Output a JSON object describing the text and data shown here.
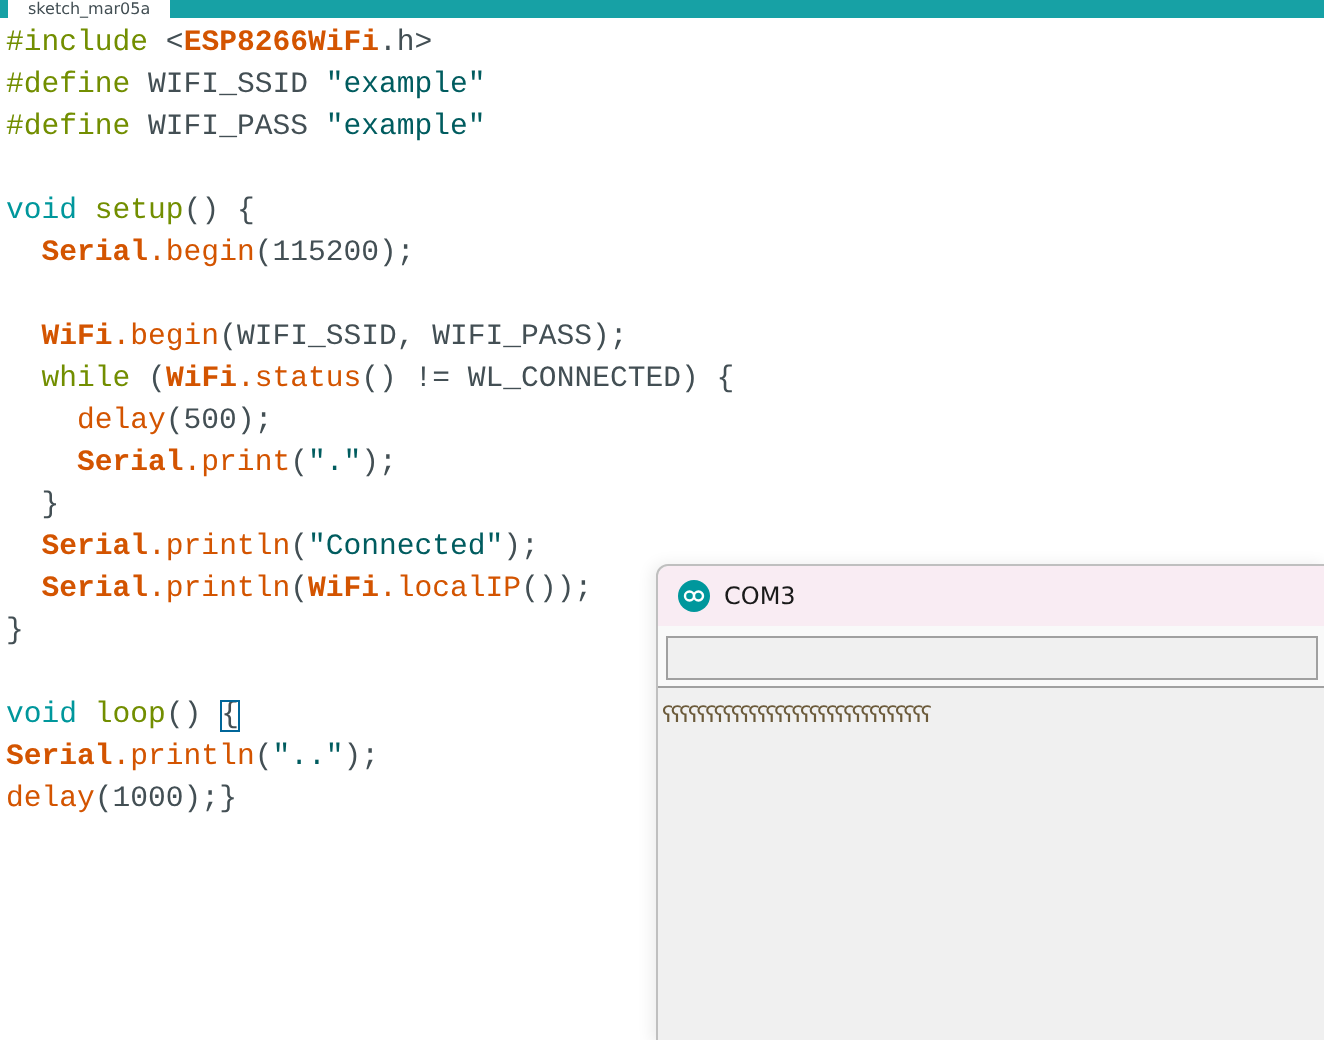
{
  "editor": {
    "tab": {
      "label": "sketch_mar05a",
      "selected": true
    },
    "blocks": [
      {
        "lines": [
          {
            "tokens": [
              {
                "text": "#include ",
                "kind": "directive"
              },
              {
                "text": "<",
                "kind": "plain"
              },
              {
                "text": "ESP8266WiFi",
                "kind": "lib"
              },
              {
                "text": ".h>",
                "kind": "plain"
              }
            ]
          },
          {
            "tokens": [
              {
                "text": "#define ",
                "kind": "directive"
              },
              {
                "text": "WIFI_SSID ",
                "kind": "plain"
              },
              {
                "text": "\"example\"",
                "kind": "string"
              }
            ]
          },
          {
            "tokens": [
              {
                "text": "#define ",
                "kind": "directive"
              },
              {
                "text": "WIFI_PASS ",
                "kind": "plain"
              },
              {
                "text": "\"example\"",
                "kind": "string"
              }
            ]
          }
        ]
      },
      {
        "lines": [
          {
            "tokens": [
              {
                "text": "void ",
                "kind": "type"
              },
              {
                "text": "setup",
                "kind": "directive"
              },
              {
                "text": "() {",
                "kind": "plain"
              }
            ]
          },
          {
            "tokens": [
              {
                "text": "  Serial",
                "kind": "class"
              },
              {
                "text": ".begin",
                "kind": "func"
              },
              {
                "text": "(115200);",
                "kind": "plain"
              }
            ]
          }
        ]
      },
      {
        "lines": [
          {
            "tokens": [
              {
                "text": "  WiFi",
                "kind": "class"
              },
              {
                "text": ".begin",
                "kind": "func"
              },
              {
                "text": "(WIFI_SSID, WIFI_PASS);",
                "kind": "plain"
              }
            ]
          },
          {
            "tokens": [
              {
                "text": "  while",
                "kind": "directive"
              },
              {
                "text": " (",
                "kind": "plain"
              },
              {
                "text": "WiFi",
                "kind": "class"
              },
              {
                "text": ".status",
                "kind": "func"
              },
              {
                "text": "() != WL_CONNECTED) {",
                "kind": "plain"
              }
            ]
          },
          {
            "tokens": [
              {
                "text": "    delay",
                "kind": "func"
              },
              {
                "text": "(500);",
                "kind": "plain"
              }
            ]
          },
          {
            "tokens": [
              {
                "text": "    Serial",
                "kind": "class"
              },
              {
                "text": ".print",
                "kind": "func"
              },
              {
                "text": "(",
                "kind": "plain"
              },
              {
                "text": "\".\"",
                "kind": "string"
              },
              {
                "text": ");",
                "kind": "plain"
              }
            ]
          },
          {
            "tokens": [
              {
                "text": "  }",
                "kind": "plain"
              }
            ]
          },
          {
            "tokens": [
              {
                "text": "  Serial",
                "kind": "class"
              },
              {
                "text": ".println",
                "kind": "func"
              },
              {
                "text": "(",
                "kind": "plain"
              },
              {
                "text": "\"Connected\"",
                "kind": "string"
              },
              {
                "text": ");",
                "kind": "plain"
              }
            ]
          },
          {
            "tokens": [
              {
                "text": "  Serial",
                "kind": "class"
              },
              {
                "text": ".println",
                "kind": "func"
              },
              {
                "text": "(",
                "kind": "plain"
              },
              {
                "text": "WiFi",
                "kind": "class"
              },
              {
                "text": ".localIP",
                "kind": "func"
              },
              {
                "text": "());",
                "kind": "plain"
              }
            ]
          },
          {
            "tokens": [
              {
                "text": "}",
                "kind": "plain"
              }
            ]
          }
        ]
      },
      {
        "lines": [
          {
            "tokens": [
              {
                "text": "void ",
                "kind": "type"
              },
              {
                "text": "loop",
                "kind": "directive"
              },
              {
                "text": "() ",
                "kind": "plain"
              },
              {
                "text": "{",
                "kind": "match"
              }
            ]
          },
          {
            "tokens": [
              {
                "text": "Serial",
                "kind": "class"
              },
              {
                "text": ".println",
                "kind": "func"
              },
              {
                "text": "(",
                "kind": "plain"
              },
              {
                "text": "\"..\"",
                "kind": "string"
              },
              {
                "text": ");",
                "kind": "plain"
              }
            ]
          },
          {
            "tokens": [
              {
                "text": "delay",
                "kind": "func"
              },
              {
                "text": "(1000);}",
                "kind": "plain"
              }
            ]
          }
        ]
      }
    ]
  },
  "serial_monitor": {
    "title": "COM3",
    "output": "ʕʕʕʕʕʕʕʕʕʕʕʕʕʕʕʕʕʕʕʕʕʕʕʕʕʕʕʕʕʕʕ"
  }
}
